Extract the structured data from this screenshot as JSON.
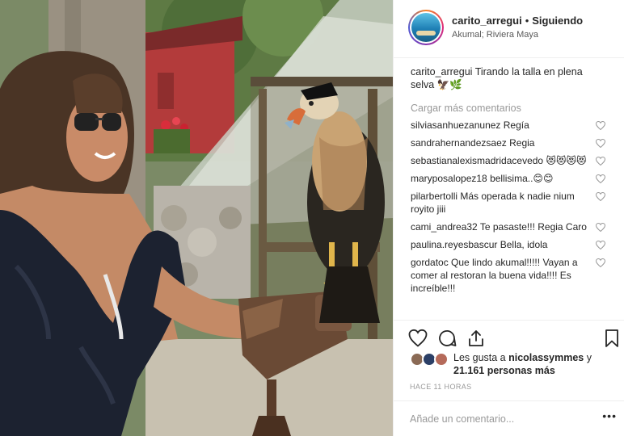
{
  "post": {
    "username": "carito_arregui",
    "separator": "•",
    "follow_status": "Siguiendo",
    "location": "Akumal; Riviera Maya",
    "avatar_icon": "beach-avatar"
  },
  "caption": {
    "username": "carito_arregui",
    "text": "Tirando la talla en plena selva 🦅🌿"
  },
  "load_more_label": "Cargar más comentarios",
  "comments": [
    {
      "user": "silviasanhuezanunez",
      "text": "Regía"
    },
    {
      "user": "sandrahernandezsaez",
      "text": "Regia"
    },
    {
      "user": "sebastianalexismadridacevedo",
      "text": "😻😻😻😻"
    },
    {
      "user": "maryposalopez18",
      "text": "bellisima..😊😊"
    },
    {
      "user": "pilarbertolli",
      "text": "Más operada k nadie nium royito jiii"
    },
    {
      "user": "cami_andrea32",
      "text": "Te pasaste!!! Regia Caro"
    },
    {
      "user": "paulina.reyesbascur",
      "text": "Bella, idola"
    },
    {
      "user": "gordatoc",
      "text": "Que lindo akumal!!!!! Vayan a comer al restoran la buena vida!!!! Es increíble!!!"
    }
  ],
  "actions": {
    "like_icon": "heart-icon",
    "comment_icon": "comment-icon",
    "share_icon": "share-icon",
    "save_icon": "bookmark-icon"
  },
  "likes": {
    "prefix": "Les gusta a ",
    "user": "nicolassymmes",
    "joiner": " y",
    "count": "21.161 personas más"
  },
  "timestamp": "HACE 11 HORAS",
  "add_comment": {
    "placeholder": "Añade un comentario...",
    "more_label": "•••"
  },
  "colors": {
    "text": "#262626",
    "muted": "#999999",
    "border": "#efefef"
  }
}
